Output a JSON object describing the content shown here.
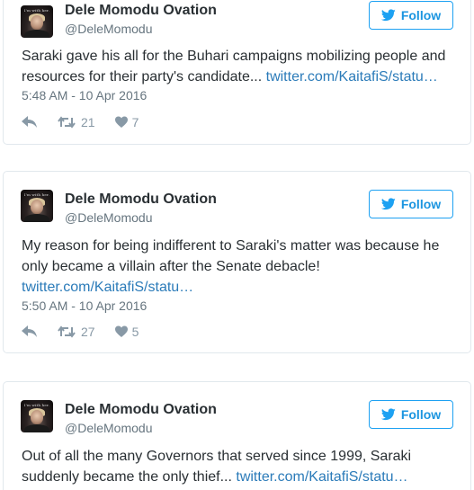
{
  "tweets": [
    {
      "name": "Dele Momodu Ovation",
      "handle": "@DeleMomodu",
      "follow_label": "Follow",
      "avatar_caption": "I'm with her.",
      "text": "Saraki gave his all for the Buhari campaigns mobilizing people and resources for their party's candidate... ",
      "link": "twitter.com/KaitafiS/statu…",
      "time": "5:48 AM - 10 Apr 2016",
      "retweets": "21",
      "likes": "7"
    },
    {
      "name": "Dele Momodu Ovation",
      "handle": "@DeleMomodu",
      "follow_label": "Follow",
      "avatar_caption": "I'm with her.",
      "text": "My reason for being indifferent to Saraki's matter was because he only became a villain after the Senate debacle! ",
      "link": "twitter.com/KaitafiS/statu…",
      "time": "5:50 AM - 10 Apr 2016",
      "retweets": "27",
      "likes": "5"
    },
    {
      "name": "Dele Momodu Ovation",
      "handle": "@DeleMomodu",
      "follow_label": "Follow",
      "avatar_caption": "I'm with her.",
      "text": "Out of all the many Governors that served since 1999, Saraki suddenly became the only thief... ",
      "link": "twitter.com/KaitafiS/statu…"
    }
  ],
  "colors": {
    "accent": "#1da1f2",
    "link": "#2b7bb9",
    "muted": "#66757f",
    "icon": "#8899a6",
    "border": "#e1e8ed"
  },
  "icons": [
    "twitter-bird-icon",
    "reply-icon",
    "retweet-icon",
    "heart-icon"
  ]
}
